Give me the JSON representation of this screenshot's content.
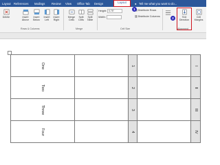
{
  "tabs": [
    "Layout",
    "References",
    "Mailings",
    "Review",
    "View",
    "Office Tab",
    "Design",
    "Layout"
  ],
  "tell_me": "Tell me what you want to do...",
  "ribbon": {
    "delete": "Delete",
    "insert_above": "Insert Above",
    "insert_below": "Insert Below",
    "insert_left": "Insert Left",
    "insert_right": "Insert Right",
    "merge_cells": "Merge Cells",
    "split_cells": "Split Cells",
    "split_table": "Split Table",
    "height_label": "Height:",
    "height_value": "0.75\"",
    "width_label": "Width:",
    "distribute_rows": "Distribute Rows",
    "distribute_columns": "Distribute Columns",
    "text_direction": "Text Direction",
    "cell_margins": "Cell Margins",
    "group_rows_columns": "Rows & Columns",
    "group_merge": "Merge",
    "group_cell_size": "Cell Size",
    "group_alignment": "Alignment"
  },
  "badges": [
    "1",
    "2"
  ],
  "table": {
    "col1": [
      "One",
      "Two",
      "Three",
      "Four"
    ],
    "col3": [
      "1",
      "2",
      "3",
      "4"
    ],
    "col4": [
      "I",
      "II",
      "III",
      "IV"
    ]
  }
}
